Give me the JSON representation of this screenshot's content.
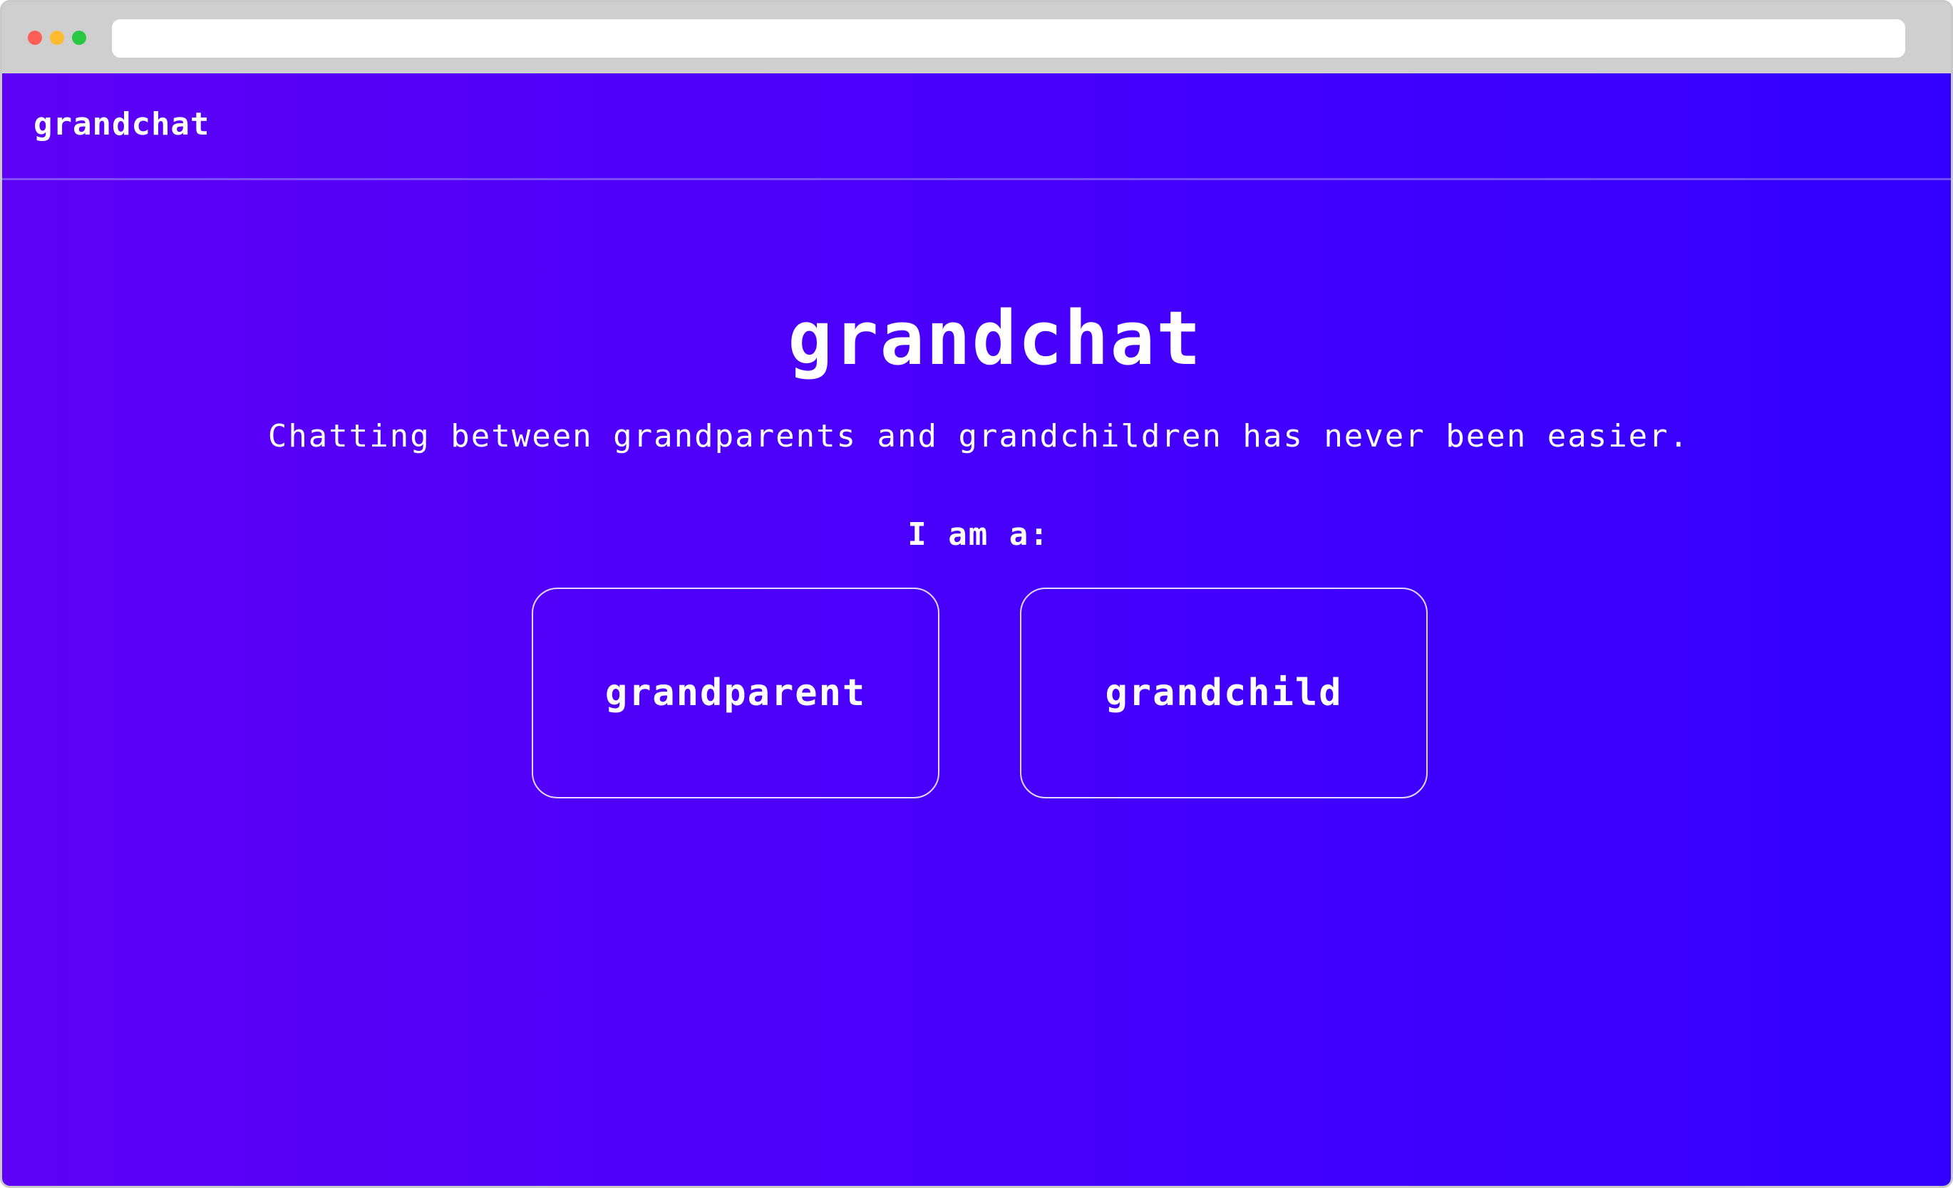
{
  "browser": {
    "address_bar_value": ""
  },
  "navbar": {
    "brand": "grandchat"
  },
  "hero": {
    "title": "grandchat",
    "subtitle": "Chatting between grandparents and grandchildren has never been easier."
  },
  "role_select": {
    "prompt": "I am a:",
    "options": [
      {
        "label": "grandparent"
      },
      {
        "label": "grandchild"
      }
    ]
  },
  "colors": {
    "gradient_start": "#5e00f5",
    "gradient_end": "#3300ff",
    "text": "#ffffff",
    "chrome": "#cfcfcf"
  }
}
